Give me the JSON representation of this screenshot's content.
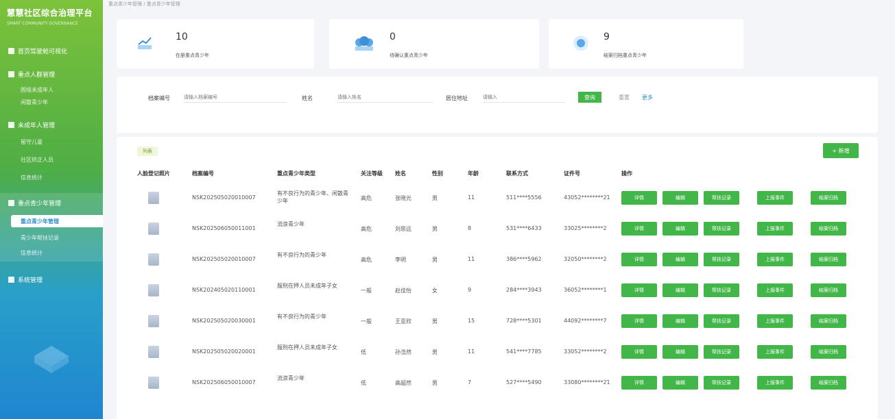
{
  "sidebar": {
    "title": "慧慧社区综合治理平台",
    "subtitle": "SMART COMMUNITY GOVERNANCE",
    "items": [
      {
        "label": "首页驾驶舱可视化"
      },
      {
        "label": "重点人群管理"
      },
      {
        "label": "未成年人管理"
      },
      {
        "label": "重点青少年管理"
      },
      {
        "label": "系统管理"
      }
    ],
    "subs": [
      {
        "label": "困境未成年人"
      },
      {
        "label": "闲散青少年"
      },
      {
        "label": "留守儿童"
      },
      {
        "label": "社区矫正人员"
      },
      {
        "label": "信息统计"
      },
      {
        "label": "重点青少年管理"
      },
      {
        "label": "青少年帮扶记录"
      },
      {
        "label": "信息统计"
      }
    ]
  },
  "breadcrumb": "重点青少年管理 / 重点青少年管理",
  "stats": [
    {
      "value": "10",
      "label": "在册重点青少年"
    },
    {
      "value": "0",
      "label": "待确认重点青少年"
    },
    {
      "value": "9",
      "label": "结案归档重点青少年"
    }
  ],
  "filter": {
    "field1_label": "档案编号",
    "field1_placeholder": "请输入档案编号",
    "field2_label": "姓名",
    "field2_placeholder": "请输入姓名",
    "field3_label": "居住地址",
    "field3_placeholder": "请输入",
    "search": "查询",
    "reset": "重置",
    "more": "更多"
  },
  "table": {
    "tag": "列表",
    "add": "+ 新增",
    "headers": [
      "人脸登记照片",
      "档案编号",
      "重点青少年类型",
      "关注等级",
      "姓名",
      "性别",
      "年龄",
      "联系方式",
      "证件号",
      "操作"
    ],
    "actions": [
      "详情",
      "编辑",
      "帮扶记录",
      "上报事件",
      "结案归档"
    ],
    "rows": [
      {
        "id": "NSK202505020010007",
        "type": "有不良行为的青少年、闲散青少年",
        "level": "高危",
        "name": "张晓光",
        "gender": "男",
        "age": "11",
        "phone": "511****5556",
        "idno": "43052********21"
      },
      {
        "id": "NSK202506050011001",
        "type": "流浪青少年",
        "level": "高危",
        "name": "刘思远",
        "gender": "男",
        "age": "8",
        "phone": "531****6433",
        "idno": "33025********2"
      },
      {
        "id": "NSK202505020010007",
        "type": "有不良行为的青少年",
        "level": "高危",
        "name": "李明",
        "gender": "男",
        "age": "11",
        "phone": "386****5962",
        "idno": "32050********2"
      },
      {
        "id": "NSK202405020110001",
        "type": "服刑在押人员未成年子女",
        "level": "一般",
        "name": "赵佳怡",
        "gender": "女",
        "age": "9",
        "phone": "284****3943",
        "idno": "36052********1"
      },
      {
        "id": "NSK202505020030001",
        "type": "有不良行为的青少年",
        "level": "一般",
        "name": "王亚欣",
        "gender": "男",
        "age": "15",
        "phone": "728****5301",
        "idno": "44092********7"
      },
      {
        "id": "NSK202505020020001",
        "type": "服刑在押人员未成年子女",
        "level": "低",
        "name": "孙浩然",
        "gender": "男",
        "age": "11",
        "phone": "541****7785",
        "idno": "33052********2"
      },
      {
        "id": "NSK202506050010007",
        "type": "流浪青少年",
        "level": "低",
        "name": "高超然",
        "gender": "男",
        "age": "7",
        "phone": "527****5490",
        "idno": "33080********21"
      }
    ]
  }
}
